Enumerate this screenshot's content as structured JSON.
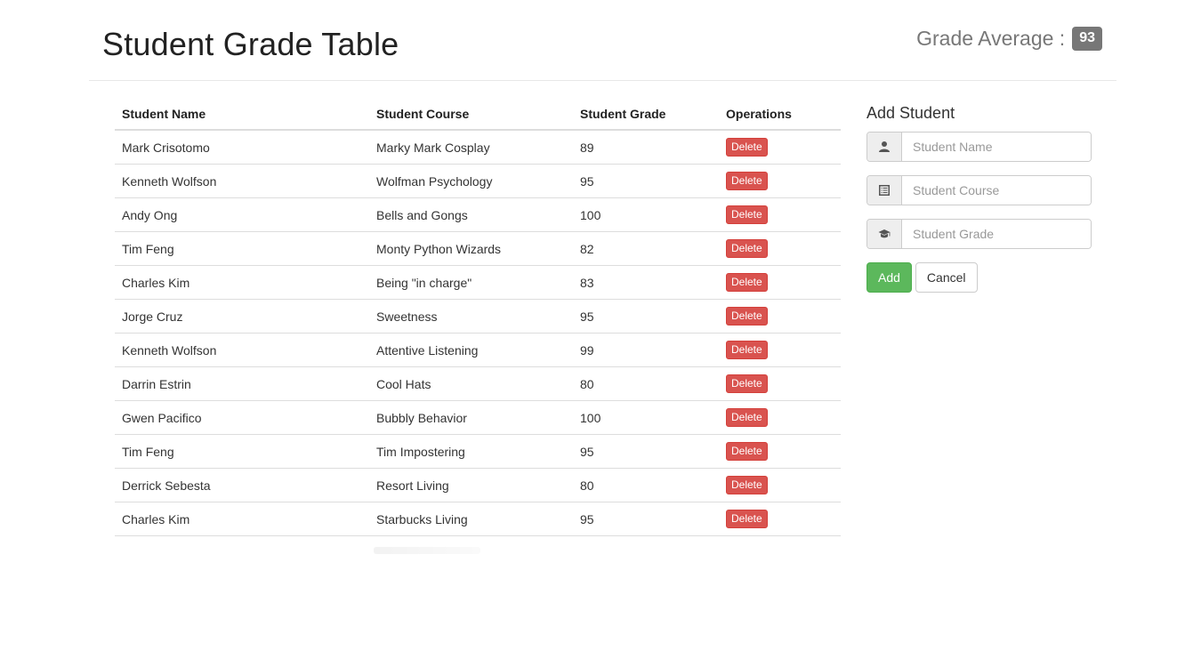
{
  "header": {
    "title": "Student Grade Table",
    "grade_average_label": "Grade Average :",
    "grade_average_value": "93"
  },
  "table": {
    "columns": [
      "Student Name",
      "Student Course",
      "Student Grade",
      "Operations"
    ],
    "rows": [
      {
        "name": "Mark Crisotomo",
        "course": "Marky Mark Cosplay",
        "grade": "89"
      },
      {
        "name": "Kenneth Wolfson",
        "course": "Wolfman Psychology",
        "grade": "95"
      },
      {
        "name": "Andy Ong",
        "course": "Bells and Gongs",
        "grade": "100"
      },
      {
        "name": "Tim Feng",
        "course": "Monty Python Wizards",
        "grade": "82"
      },
      {
        "name": "Charles Kim",
        "course": "Being \"in charge\"",
        "grade": "83"
      },
      {
        "name": "Jorge Cruz",
        "course": "Sweetness",
        "grade": "95"
      },
      {
        "name": "Kenneth Wolfson",
        "course": "Attentive Listening",
        "grade": "99"
      },
      {
        "name": "Darrin Estrin",
        "course": "Cool Hats",
        "grade": "80"
      },
      {
        "name": "Gwen Pacifico",
        "course": "Bubbly Behavior",
        "grade": "100"
      },
      {
        "name": "Tim Feng",
        "course": "Tim Impostering",
        "grade": "95"
      },
      {
        "name": "Derrick Sebesta",
        "course": "Resort Living",
        "grade": "80"
      },
      {
        "name": "Charles Kim",
        "course": "Starbucks Living",
        "grade": "95"
      }
    ],
    "delete_label": "Delete"
  },
  "form": {
    "title": "Add Student",
    "name_placeholder": "Student Name",
    "course_placeholder": "Student Course",
    "grade_placeholder": "Student Grade",
    "add_label": "Add",
    "cancel_label": "Cancel"
  },
  "colors": {
    "delete": "#d9534f",
    "add": "#5cb85c",
    "badge": "#777777"
  }
}
